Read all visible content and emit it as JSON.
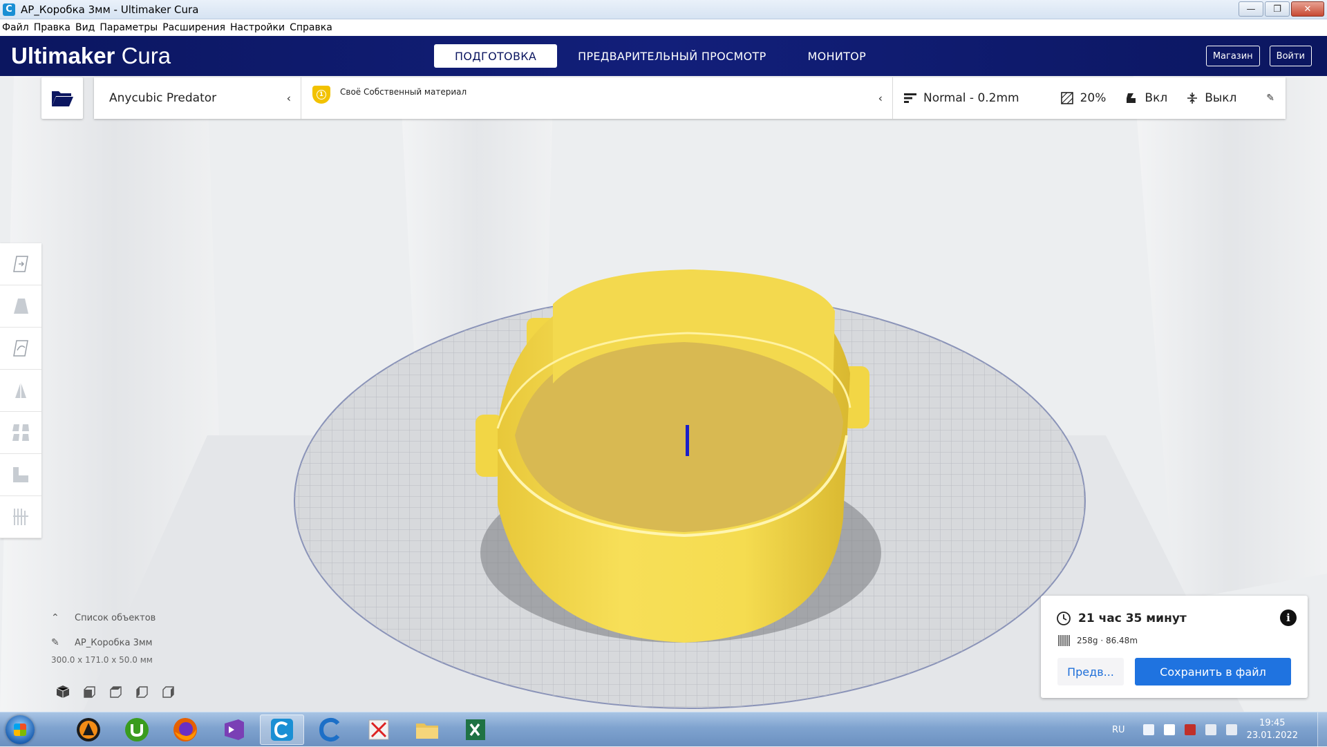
{
  "window": {
    "title": "АР_Коробка 3мм - Ultimaker Cura",
    "app_icon_letter": "C",
    "minimize": "—",
    "maximize": "❐",
    "close": "✕"
  },
  "menu": [
    "Файл",
    "Правка",
    "Вид",
    "Параметры",
    "Расширения",
    "Настройки",
    "Справка"
  ],
  "header": {
    "logo_bold": "Ultimaker",
    "logo_light": "Cura",
    "tabs": [
      {
        "label": "ПОДГОТОВКА",
        "active": true
      },
      {
        "label": "ПРЕДВАРИТЕЛЬНЫЙ ПРОСМОТР",
        "active": false
      },
      {
        "label": "МОНИТОР",
        "active": false
      }
    ],
    "marketplace_label": "Магазин",
    "signin_label": "Войти"
  },
  "config": {
    "printer": "Anycubic Predator",
    "extruder_number": "1",
    "material": "Своё Собственный материал",
    "profile": "Normal - 0.2mm",
    "infill": "20%",
    "support": "Вкл",
    "adhesion": "Выкл"
  },
  "object_list": {
    "toggle_label": "Список объектов",
    "object_name": "АР_Коробка 3мм",
    "dimensions": "300.0 x 171.0 x 50.0 мм"
  },
  "print_panel": {
    "time": "21 час 35 минут",
    "usage": "258g · 86.48m",
    "preview_label": "Предв...",
    "save_label": "Сохранить в файл",
    "info_glyph": "i"
  },
  "taskbar": {
    "lang": "RU",
    "time": "19:45",
    "date": "23.01.2022"
  },
  "colors": {
    "header_bg": "#121f7a",
    "accent_blue": "#1f73e0",
    "model_yellow": "#f6dc52",
    "extruder_yellow": "#f2c200"
  }
}
